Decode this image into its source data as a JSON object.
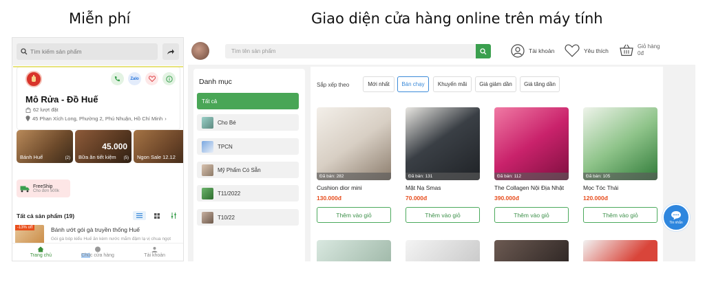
{
  "headings": {
    "left": "Miễn phí",
    "right": "Giao diện cửa hàng online trên máy tính"
  },
  "mobile": {
    "search_placeholder": "Tìm kiếm sản phẩm",
    "shop_name": "Mô Rửa - Đồ Huế",
    "followers": "62 lượt đặt",
    "address": "45 Phan Xích Long, Phường 2, Phú Nhuận, Hồ Chí Minh",
    "shop_actions": [
      "phone-icon",
      "zalo-icon",
      "heart-icon",
      "info-icon"
    ],
    "banners": [
      {
        "label": "Bánh Huế",
        "count": "(2)",
        "big": ""
      },
      {
        "label": "Bữa ăn tiết kiệm",
        "count": "(5)",
        "big": "45.000"
      },
      {
        "label": "Ngon Sale 12.12",
        "count": "",
        "big": ""
      }
    ],
    "freeship_title": "FreeShip",
    "freeship_sub": "Cho đơn 500k",
    "all_products": "Tất cả sản phẩm (19)",
    "product": {
      "discount": "-13% off",
      "title": "Bánh ướt gói gà truyền thống Huế",
      "desc": "Gói gà bóp kiểu Huế ăn kèm nước mắm đậm lạ vị chua ngọt"
    },
    "bottom_nav": [
      "Trang chủ",
      "Chú",
      "c cửa hàng",
      "Tài khoản"
    ],
    "colors": {
      "accent_stripe": "#e6e27a",
      "active_nav": "#3a8f3a",
      "price": "#e74c1c"
    }
  },
  "desktop": {
    "search_placeholder": "Tìm tên sản phẩm",
    "account": "Tài khoản",
    "favorite": "Yêu thích",
    "cart_label": "Giỏ hàng",
    "cart_amount": "0đ",
    "categories_title": "Danh mục",
    "categories": [
      "Tất cả",
      "Cho Bé",
      "TPCN",
      "Mỹ Phẩm Có Sẵn",
      "T11/2022",
      "T10/22"
    ],
    "sort_label": "Sắp xếp theo",
    "sort_options": [
      "Mới nhất",
      "Bán chạy",
      "Khuyến mãi",
      "Giá giảm dần",
      "Giá tăng dần"
    ],
    "sort_active": "Bán chạy",
    "products": [
      {
        "name": "Cushion dior mini",
        "price": "130.000đ",
        "sold": "Đã bán: 282"
      },
      {
        "name": "Mặt Nạ Smas",
        "price": "70.000đ",
        "sold": "Đã bán: 131"
      },
      {
        "name": "The Collagen Nội Địa Nhật",
        "price": "390.000đ",
        "sold": "Đã bán: 112"
      },
      {
        "name": "Mọc Tóc Thái",
        "price": "120.000đ",
        "sold": "Đã bán: 105"
      }
    ],
    "add_to_cart": "Thêm vào giỏ",
    "chat_label": "Tin nhắn",
    "colors": {
      "primary_green": "#49a656",
      "price": "#e74c1c",
      "sort_active": "#3b8ad8",
      "chat": "#2e86de"
    }
  }
}
